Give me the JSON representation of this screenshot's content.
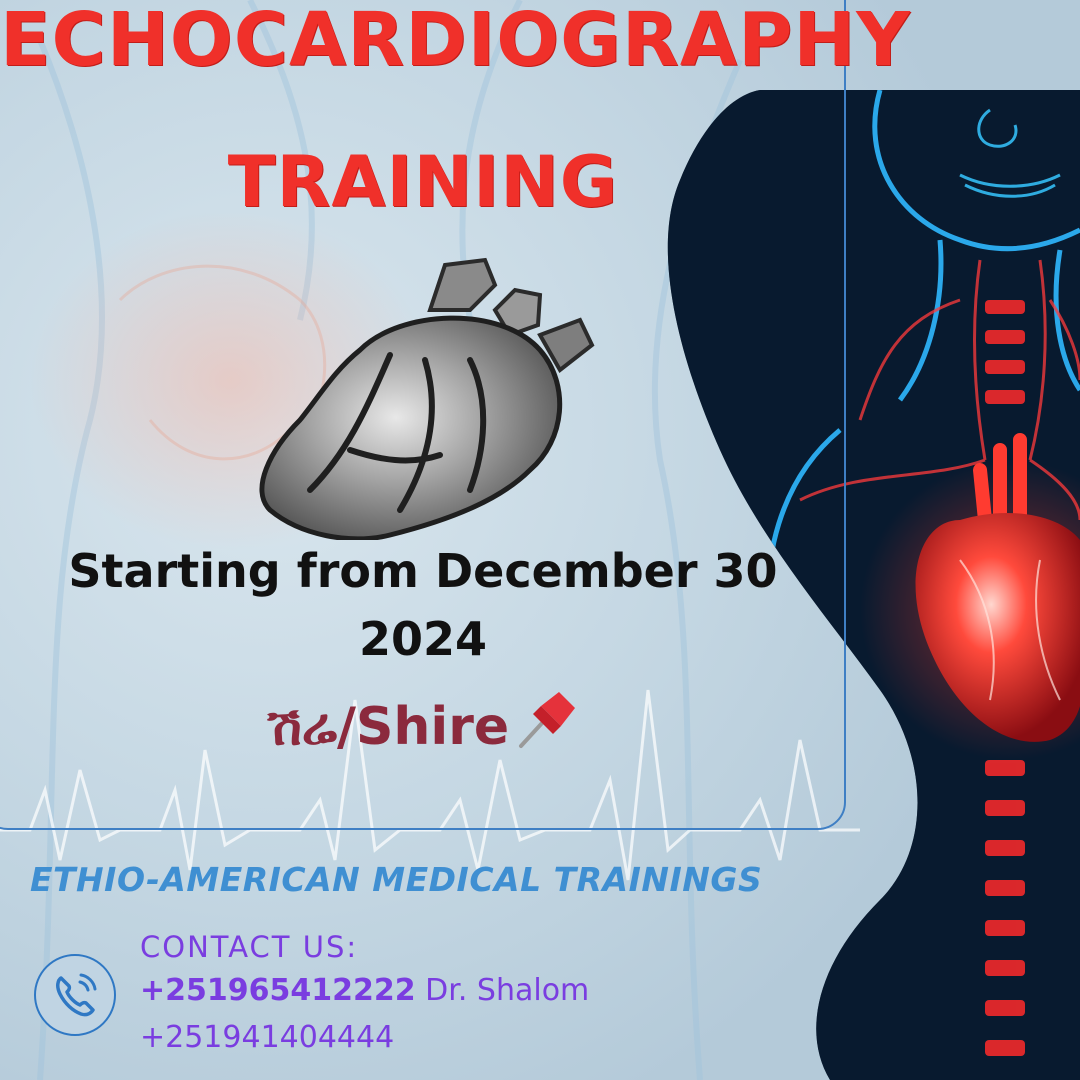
{
  "flyer": {
    "title_line1": "ECHOCARDIOGRAPHY",
    "title_line2": "TRAINING",
    "date_line1": "Starting from December 30",
    "date_line2": "2024",
    "location": "ሽሬ/Shire"
  },
  "organization": {
    "name": "ETHIO-AMERICAN MEDICAL TRAININGS"
  },
  "contact": {
    "label": "CONTACT US:",
    "phone1": "+251965412222",
    "person": " Dr. Shalom",
    "phone2": "+251941404444"
  },
  "icons": {
    "heart": "anatomical-heart-icon",
    "pin": "pushpin-icon",
    "phone": "phone-icon"
  },
  "colors": {
    "title": "#f0302a",
    "location": "#8b2a3d",
    "org": "#3f8fd2",
    "contact": "#7a3de0",
    "panel_border": "#3f7fc4"
  }
}
